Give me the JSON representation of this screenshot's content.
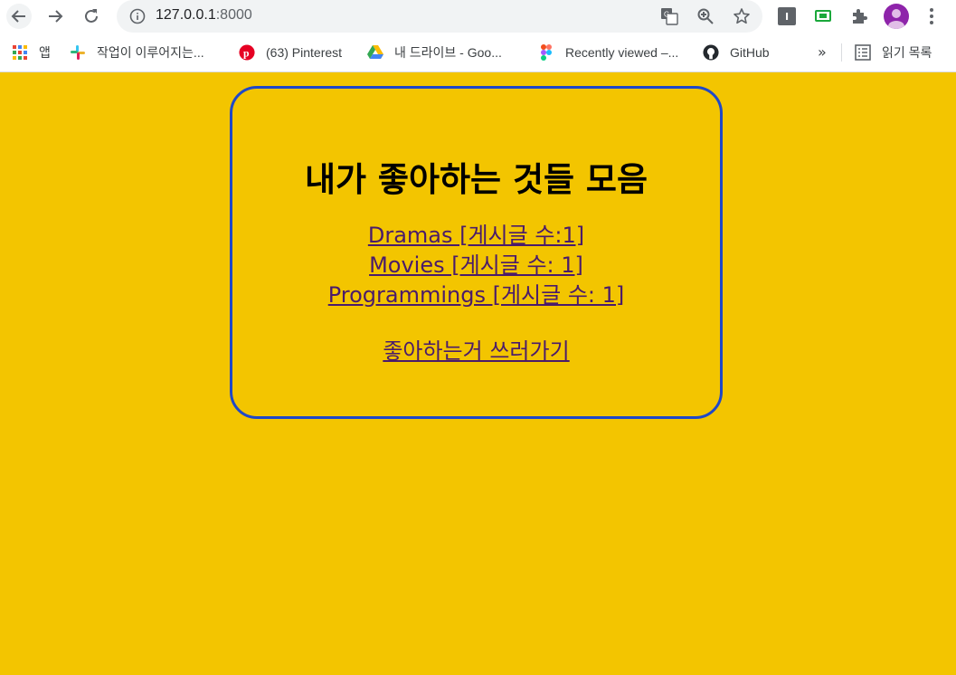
{
  "browser": {
    "url_host": "127.0.0.1",
    "url_port": ":8000",
    "extension_label": "I"
  },
  "bookmarks": [
    {
      "label": "앱",
      "icon": "apps-grid-icon"
    },
    {
      "label": "작업이 이루어지는...",
      "icon": "slack-icon"
    },
    {
      "label": "(63) Pinterest",
      "icon": "pinterest-icon"
    },
    {
      "label": "내 드라이브 - Goo...",
      "icon": "google-drive-icon"
    },
    {
      "label": "Recently viewed –...",
      "icon": "figma-icon"
    },
    {
      "label": "GitHub",
      "icon": "github-icon"
    }
  ],
  "bookmarks_more": "»",
  "reading_list": {
    "label": "읽기 목록",
    "icon": "reading-list-icon"
  },
  "page": {
    "title": "내가 좋아하는 것들 모음",
    "categories": [
      {
        "label": "Dramas [게시글 수:1]"
      },
      {
        "label": "Movies [게시글 수: 1]"
      },
      {
        "label": "Programmings [게시글 수: 1]"
      }
    ],
    "write_link": "좋아하는거 쓰러가기"
  },
  "colors": {
    "page_background": "#f3c500",
    "card_border": "#1f48c8",
    "link": "#4a1b6b"
  }
}
